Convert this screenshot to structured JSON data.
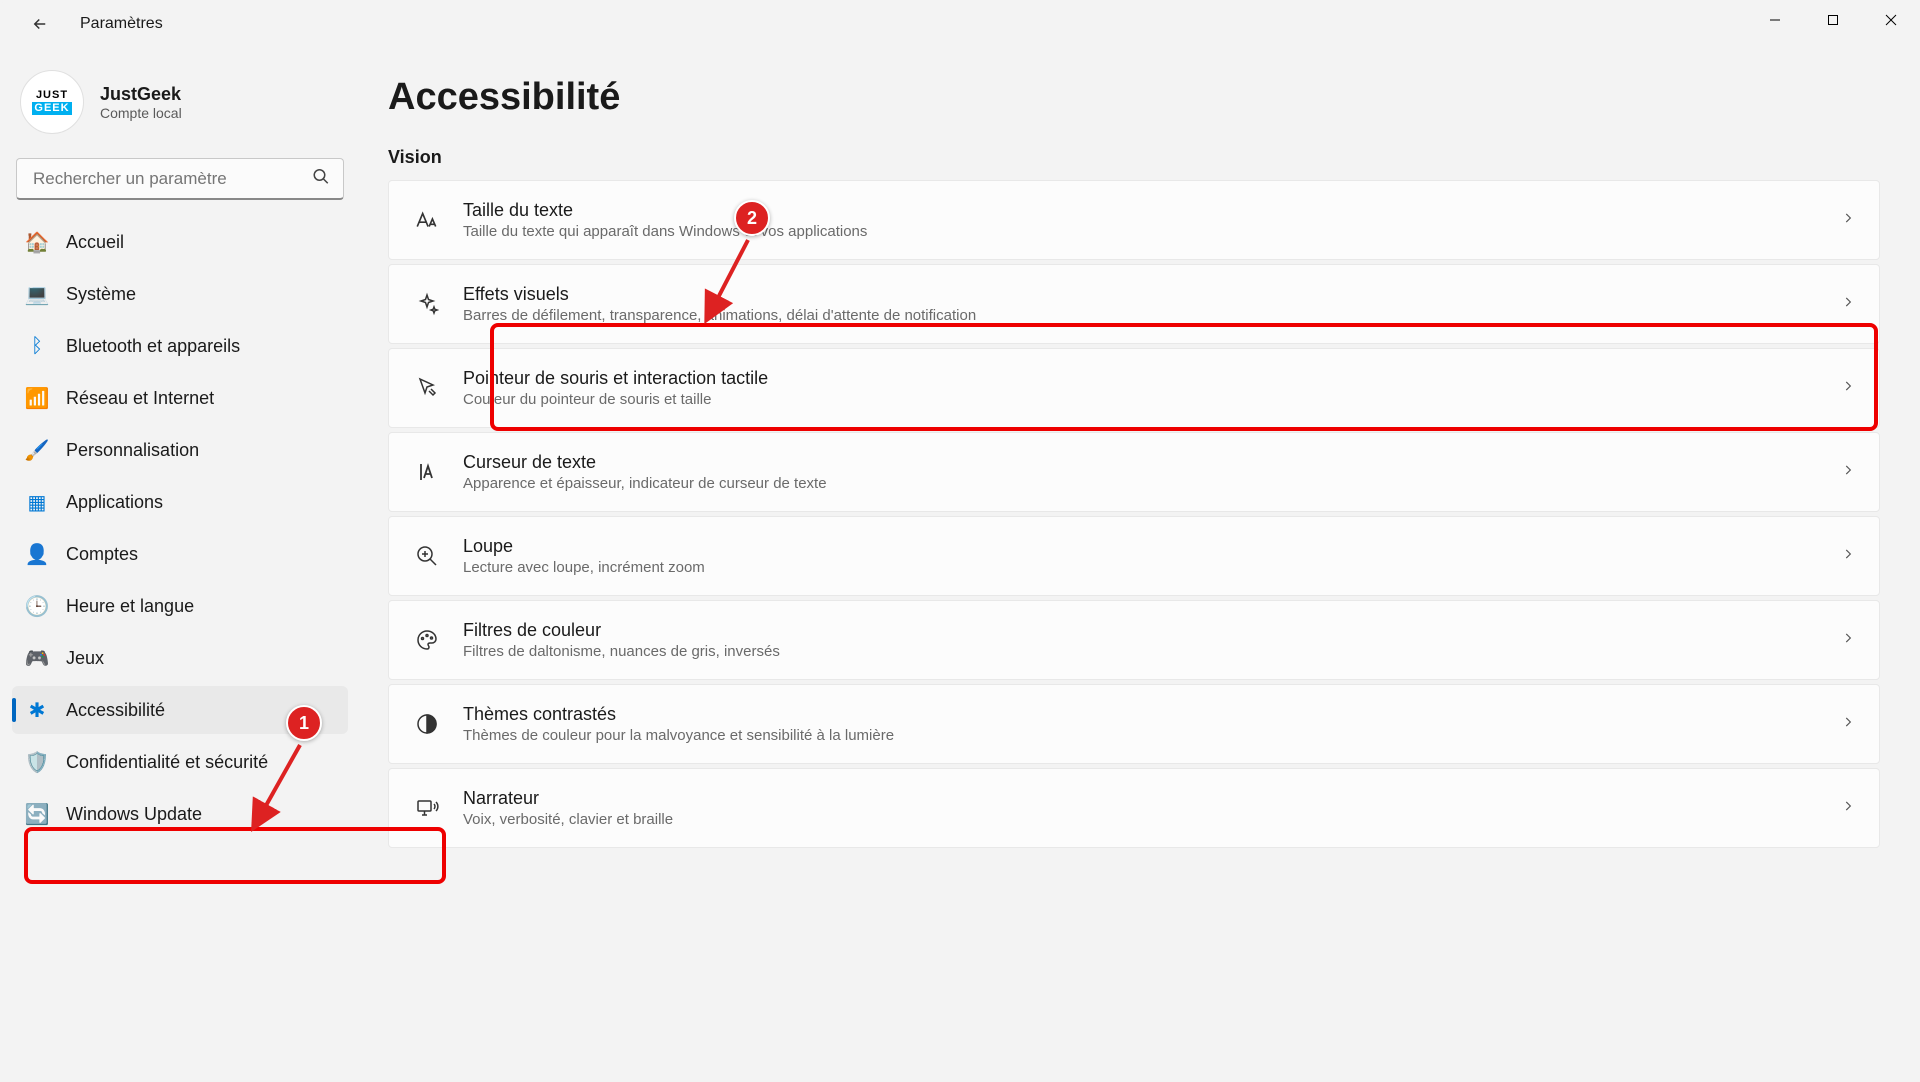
{
  "app_title": "Paramètres",
  "win_controls": {
    "min": "minimize",
    "max": "maximize",
    "close": "close"
  },
  "profile": {
    "avatar_top": "JUST",
    "avatar_bottom": "GEEK",
    "name": "JustGeek",
    "sub": "Compte local"
  },
  "search": {
    "placeholder": "Rechercher un paramètre"
  },
  "nav": [
    {
      "id": "home",
      "label": "Accueil",
      "icon": "🏠",
      "color": "#f2994a",
      "active": false
    },
    {
      "id": "system",
      "label": "Système",
      "icon": "💻",
      "color": "#0078d4",
      "active": false
    },
    {
      "id": "bluetooth",
      "label": "Bluetooth et appareils",
      "icon": "ᛒ",
      "color": "#0078d4",
      "active": false
    },
    {
      "id": "network",
      "label": "Réseau et Internet",
      "icon": "📶",
      "color": "#0099e5",
      "active": false
    },
    {
      "id": "personalization",
      "label": "Personnalisation",
      "icon": "🖌️",
      "color": "#ef821d",
      "active": false
    },
    {
      "id": "apps",
      "label": "Applications",
      "icon": "▦",
      "color": "#0078d4",
      "active": false
    },
    {
      "id": "accounts",
      "label": "Comptes",
      "icon": "👤",
      "color": "#1aab8a",
      "active": false
    },
    {
      "id": "time",
      "label": "Heure et langue",
      "icon": "🕒",
      "color": "#5b5b5b",
      "active": false
    },
    {
      "id": "gaming",
      "label": "Jeux",
      "icon": "🎮",
      "color": "#888",
      "active": false
    },
    {
      "id": "accessibility",
      "label": "Accessibilité",
      "icon": "✱",
      "color": "#0078d4",
      "active": true
    },
    {
      "id": "privacy",
      "label": "Confidentialité et sécurité",
      "icon": "🛡️",
      "color": "#888",
      "active": false
    },
    {
      "id": "update",
      "label": "Windows Update",
      "icon": "🔄",
      "color": "#0078d4",
      "active": false
    }
  ],
  "main": {
    "title": "Accessibilité",
    "section": "Vision",
    "cards": [
      {
        "id": "text-size",
        "title": "Taille du texte",
        "sub": "Taille du texte qui apparaît dans Windows et vos applications",
        "icon": "text-size"
      },
      {
        "id": "visual-effects",
        "title": "Effets visuels",
        "sub": "Barres de défilement, transparence, animations, délai d'attente de notification",
        "icon": "sparkle"
      },
      {
        "id": "mouse-pointer",
        "title": "Pointeur de souris et interaction tactile",
        "sub": "Couleur du pointeur de souris et taille",
        "icon": "cursor"
      },
      {
        "id": "text-cursor",
        "title": "Curseur de texte",
        "sub": "Apparence et épaisseur, indicateur de curseur de texte",
        "icon": "text-cursor"
      },
      {
        "id": "magnifier",
        "title": "Loupe",
        "sub": "Lecture avec loupe, incrément zoom",
        "icon": "magnifier"
      },
      {
        "id": "color-filters",
        "title": "Filtres de couleur",
        "sub": "Filtres de daltonisme, nuances de gris, inversés",
        "icon": "palette"
      },
      {
        "id": "contrast",
        "title": "Thèmes contrastés",
        "sub": "Thèmes de couleur pour la malvoyance et sensibilité à la lumière",
        "icon": "contrast"
      },
      {
        "id": "narrator",
        "title": "Narrateur",
        "sub": "Voix, verbosité, clavier et braille",
        "icon": "screen-reader"
      }
    ]
  },
  "annotations": {
    "badge1": "1",
    "badge2": "2"
  }
}
